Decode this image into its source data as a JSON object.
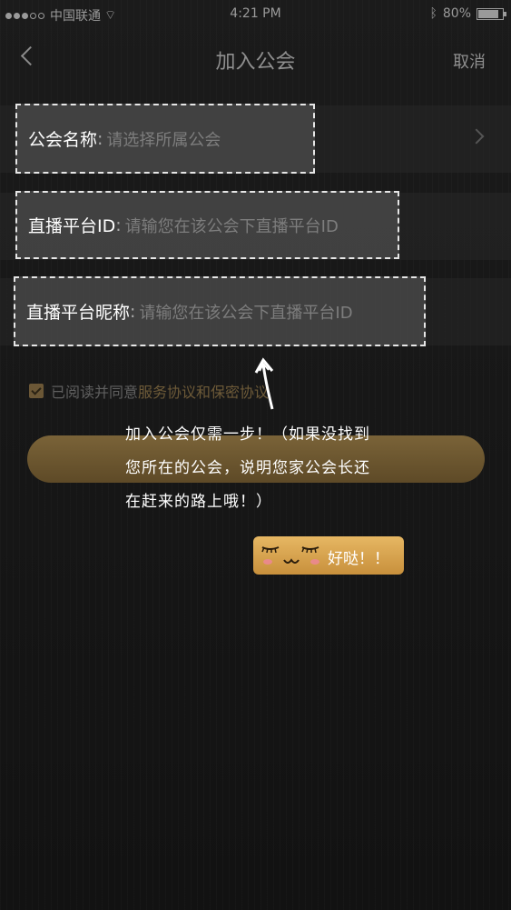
{
  "status": {
    "carrier": "中国联通",
    "time": "4:21 PM",
    "battery": "80%",
    "battery_level": 0.8
  },
  "nav": {
    "title": "加入公会",
    "cancel": "取消"
  },
  "form": {
    "guild_name": {
      "label": "公会名称",
      "placeholder": "请选择所属公会"
    },
    "platform_id": {
      "label": "直播平台ID",
      "placeholder": "请输您在该公会下直播平台ID"
    },
    "platform_nick": {
      "label": "直播平台昵称",
      "placeholder": "请输您在该公会下直播平台ID"
    }
  },
  "agreement": {
    "prefix": "已阅读并同意",
    "link": "服务协议和保密协议"
  },
  "tip": {
    "text": "加入公会仅需一步！（如果没找到您所在的公会，说明您家公会长还在赶来的路上哦！）",
    "badge": "好哒！！"
  },
  "colors": {
    "accent_gold": "#c8903c",
    "button_bg": "#6b5630"
  }
}
